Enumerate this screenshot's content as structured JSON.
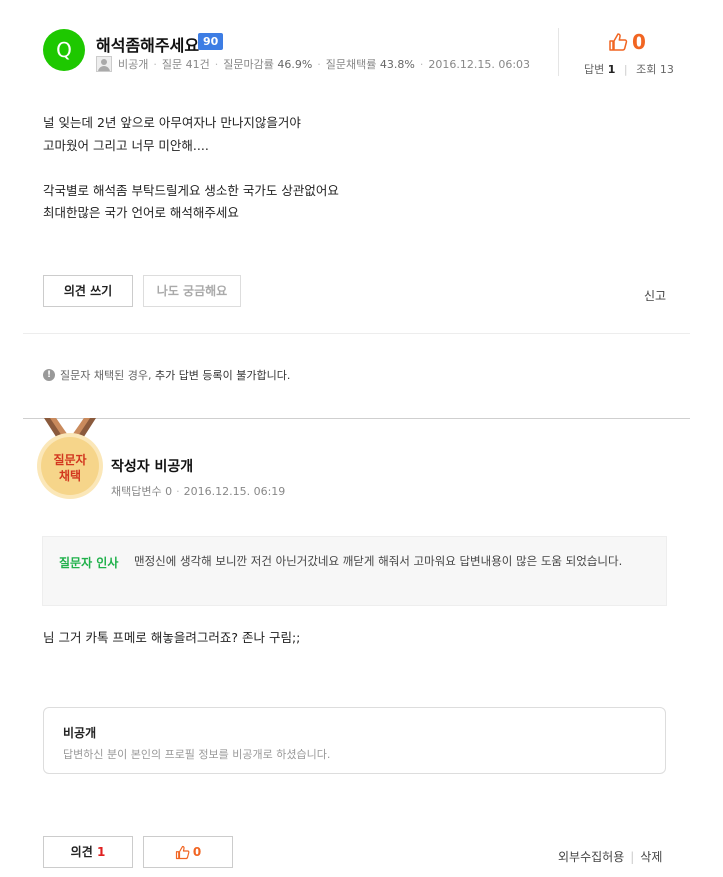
{
  "question": {
    "avatar_letter": "Q",
    "title": "해석좀해주세요",
    "badge": "90",
    "meta": {
      "author": "비공개",
      "question_count": "질문 41건",
      "close_rate_label": "질문마감률",
      "close_rate": "46.9%",
      "adopt_rate_label": "질문채택률",
      "adopt_rate": "43.8%",
      "date": "2016.12.15. 06:03"
    },
    "likes": "0",
    "stats": {
      "answers_label": "답변",
      "answers": "1",
      "views_label": "조회",
      "views": "13"
    },
    "body": "널 잊는데 2년 앞으로 아무여자나 만나지않을거야\n고마웠어 그리고 너무 미안해....\n\n각국별로 해석좀 부탁드릴게요 생소한 국가도 상관없어요\n최대한많은 국가 언어로 해석해주세요",
    "write_opinion": "의견 쓰기",
    "me_too": "나도 궁금해요",
    "report": "신고"
  },
  "notice": {
    "part1": "질문자 채택된 경우,",
    "part2": "추가 답변 등록이 불가합니다."
  },
  "answer": {
    "medal_line1": "질문자",
    "medal_line2": "채택",
    "author": "작성자 비공개",
    "adopt_count": "채택답변수 0",
    "date": "2016.12.15. 06:19",
    "thanks_label": "질문자 인사",
    "thanks_text": "맨정신에 생각해 보니깐 저건 아닌거갔네요 깨닫게 해줘서 고마워요 답변내용이 많은 도움 되었습니다.",
    "body": "님 그거 카톡 프메로 해놓을려그러죠? 존나 구림;;",
    "profile_title": "비공개",
    "profile_desc": "답변하신 분이 본인의 프로필 정보를 비공개로 하셨습니다.",
    "opinion_label": "의견",
    "opinion_count": "1",
    "likes": "0",
    "allow_collect": "외부수집허용",
    "delete": "삭제"
  },
  "colors": {
    "accent_green": "#1ec800",
    "badge_blue": "#3d7de4",
    "like_orange": "#f16522",
    "thanks_green": "#20b14b",
    "medal_gold": "#f6d58a"
  }
}
